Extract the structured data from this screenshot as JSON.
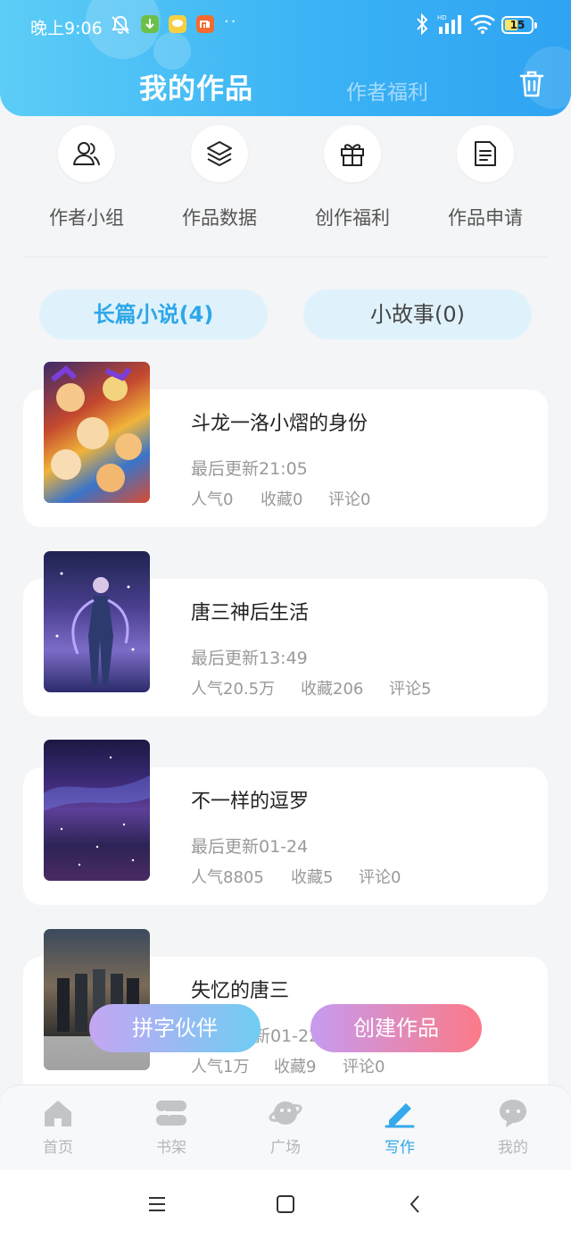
{
  "status_bar": {
    "time": "晚上9:06",
    "dots": "··",
    "battery": "15",
    "signal_label": "HD"
  },
  "header": {
    "active_tab": "我的作品",
    "other_tab": "作者福利"
  },
  "quick_actions": [
    {
      "label": "作者小组",
      "icon": "people-icon"
    },
    {
      "label": "作品数据",
      "icon": "layers-icon"
    },
    {
      "label": "创作福利",
      "icon": "gift-icon"
    },
    {
      "label": "作品申请",
      "icon": "document-icon"
    }
  ],
  "segments": {
    "long_novel": "长篇小说(4)",
    "short_story": "小故事(0)"
  },
  "works": [
    {
      "title": "斗龙一洛小熠的身份",
      "updated": "最后更新21:05",
      "popularity": "人气0",
      "favorites": "收藏0",
      "comments": "评论0"
    },
    {
      "title": "唐三神后生活",
      "updated": "最后更新13:49",
      "popularity": "人气20.5万",
      "favorites": "收藏206",
      "comments": "评论5"
    },
    {
      "title": "不一样的逗罗",
      "updated": "最后更新01-24",
      "popularity": "人气8805",
      "favorites": "收藏5",
      "comments": "评论0"
    },
    {
      "title": "失忆的唐三",
      "updated": "新01-22",
      "popularity": "人气1万",
      "favorites": "收藏9",
      "comments": "评论0"
    }
  ],
  "floating": {
    "partner": "拼字伙伴",
    "create": "创建作品"
  },
  "bottom_nav": [
    {
      "label": "首页"
    },
    {
      "label": "书架"
    },
    {
      "label": "广场"
    },
    {
      "label": "写作"
    },
    {
      "label": "我的"
    }
  ],
  "colors": {
    "accent": "#2ea7e8",
    "header_start": "#5ccdf6",
    "header_end": "#2fa3f2",
    "create_pink": "#fb7a88"
  }
}
